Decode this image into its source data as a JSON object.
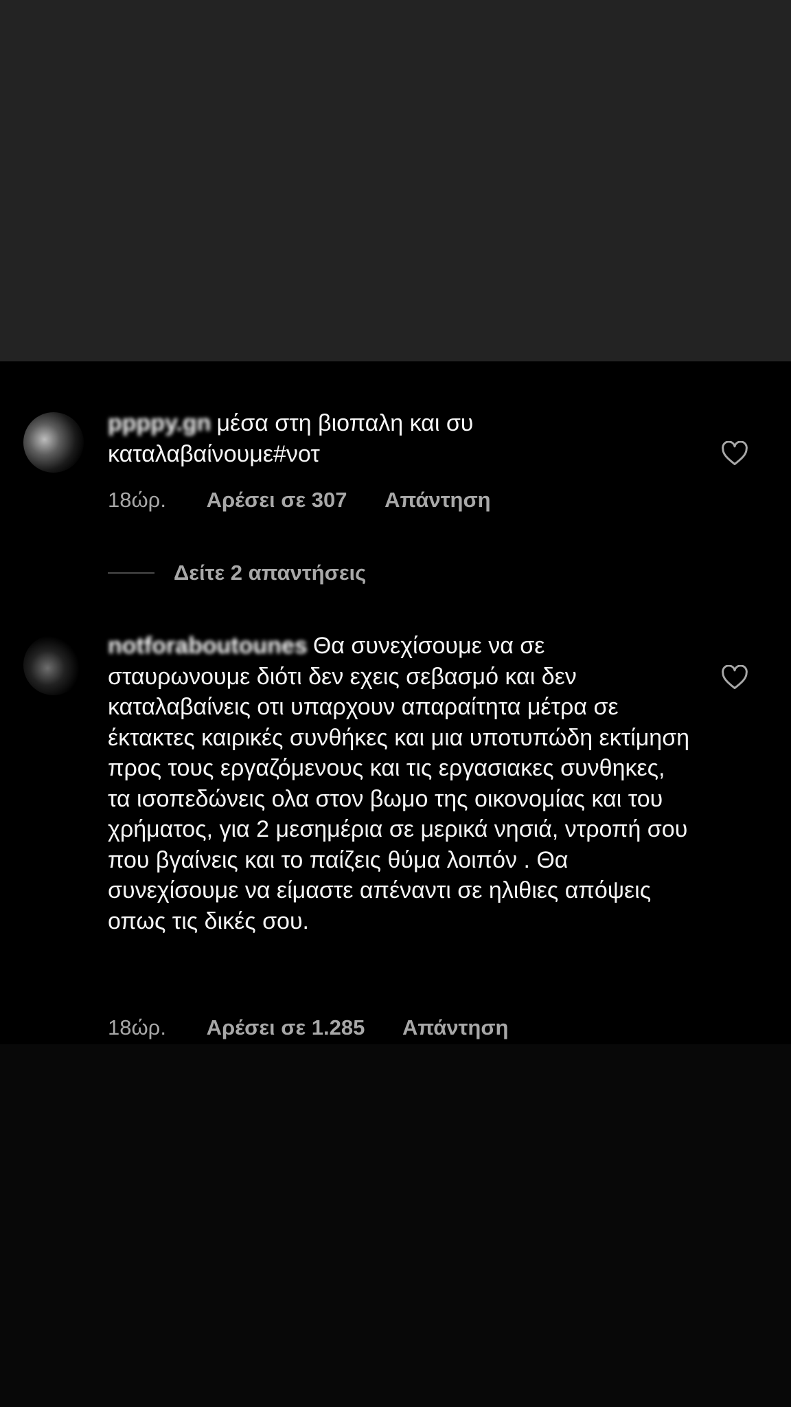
{
  "comments": [
    {
      "username": "ppppy.gn",
      "text": "μέσα στη βιοπαλη και συ καταλαβαίνουμε#νοτ",
      "time": "18ώρ.",
      "likes": "Αρέσει σε 307",
      "reply": "Απάντηση"
    },
    {
      "username": "notforaboutounes",
      "text": "Θα συνεχίσουμε να σε σταυρωνουμε διότι δεν εχεις σεβασμό και δεν καταλαβαίνεις οτι υπαρχουν απαραίτητα μέτρα σε έκτακτες καιρικές συνθήκες και μια υποτυπώδη εκτίμηση προς τους εργαζόμενους και τις εργασιακες συνθηκες, τα ισοπεδώνεις ολα στον βωμο της οικονομίας και του χρήματος, για 2 μεσημέρια σε μερικά νησιά, ντροπή σου που βγαίνεις και το παίζεις θύμα λοιπόν . Θα συνεχίσουμε να είμαστε απέναντι σε ηλιθιες απόψεις οπως τις δικές σου.",
      "time": "18ώρ.",
      "likes": "Αρέσει σε 1.285",
      "reply": "Απάντηση"
    }
  ],
  "view_replies": "Δείτε 2 απαντήσεις",
  "icons": {
    "like": "heart-outline-icon"
  },
  "colors": {
    "background": "#000000",
    "outer_background": "#232323",
    "secondary_text": "#a8a8a8",
    "primary_text": "#f5f5f5"
  }
}
